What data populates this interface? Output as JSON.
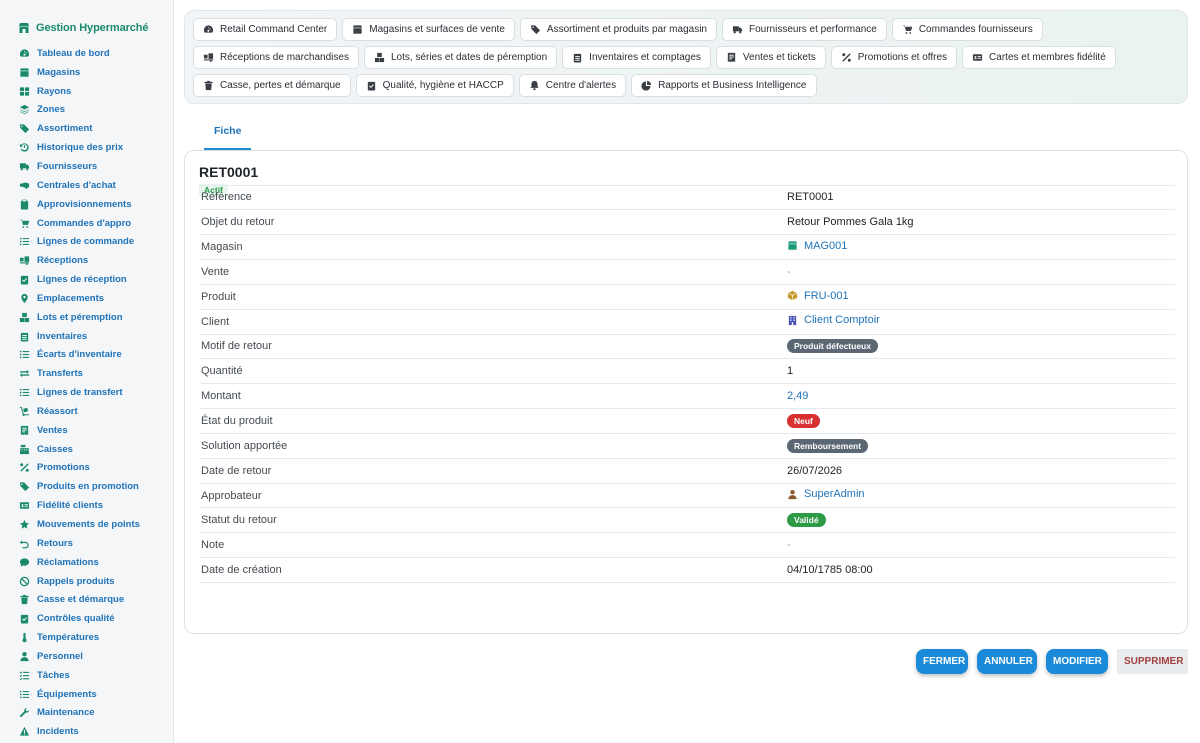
{
  "sidebar": {
    "brand": "Gestion Hypermarché",
    "items": [
      {
        "label": "Tableau de bord",
        "icon": "gauge-icon"
      },
      {
        "label": "Magasins",
        "icon": "store-icon"
      },
      {
        "label": "Rayons",
        "icon": "grid-icon"
      },
      {
        "label": "Zones",
        "icon": "layers-icon"
      },
      {
        "label": "Assortiment",
        "icon": "tags-icon"
      },
      {
        "label": "Historique des prix",
        "icon": "history-icon"
      },
      {
        "label": "Fournisseurs",
        "icon": "truck-icon"
      },
      {
        "label": "Centrales d'achat",
        "icon": "handshake-icon"
      },
      {
        "label": "Approvisionnements",
        "icon": "clipboard-icon"
      },
      {
        "label": "Commandes d'appro",
        "icon": "cart-icon"
      },
      {
        "label": "Lignes de commande",
        "icon": "list-icon"
      },
      {
        "label": "Réceptions",
        "icon": "truck-loading-icon"
      },
      {
        "label": "Lignes de réception",
        "icon": "clipboard-check-icon"
      },
      {
        "label": "Emplacements",
        "icon": "map-pin-icon"
      },
      {
        "label": "Lots et péremption",
        "icon": "boxes-icon"
      },
      {
        "label": "Inventaires",
        "icon": "clipboard-list-icon"
      },
      {
        "label": "Écarts d'inventaire",
        "icon": "list-icon"
      },
      {
        "label": "Transferts",
        "icon": "exchange-icon"
      },
      {
        "label": "Lignes de transfert",
        "icon": "list-icon"
      },
      {
        "label": "Réassort",
        "icon": "dolly-icon"
      },
      {
        "label": "Ventes",
        "icon": "receipt-icon"
      },
      {
        "label": "Caisses",
        "icon": "cash-register-icon"
      },
      {
        "label": "Promotions",
        "icon": "percent-icon"
      },
      {
        "label": "Produits en promotion",
        "icon": "tag-icon"
      },
      {
        "label": "Fidélité clients",
        "icon": "id-card-icon"
      },
      {
        "label": "Mouvements de points",
        "icon": "star-icon"
      },
      {
        "label": "Retours",
        "icon": "undo-icon"
      },
      {
        "label": "Réclamations",
        "icon": "comment-icon"
      },
      {
        "label": "Rappels produits",
        "icon": "ban-icon"
      },
      {
        "label": "Casse et démarque",
        "icon": "trash-icon"
      },
      {
        "label": "Contrôles qualité",
        "icon": "clipboard-check-icon"
      },
      {
        "label": "Températures",
        "icon": "thermometer-icon"
      },
      {
        "label": "Personnel",
        "icon": "user-icon"
      },
      {
        "label": "Tâches",
        "icon": "tasks-icon"
      },
      {
        "label": "Équipements",
        "icon": "list-icon"
      },
      {
        "label": "Maintenance",
        "icon": "wrench-icon"
      },
      {
        "label": "Incidents",
        "icon": "warning-icon"
      }
    ]
  },
  "topnav": {
    "chips": [
      {
        "label": "Retail Command Center",
        "icon": "gauge-icon"
      },
      {
        "label": "Magasins et surfaces de vente",
        "icon": "store-icon"
      },
      {
        "label": "Assortiment et produits par magasin",
        "icon": "tags-icon"
      },
      {
        "label": "Fournisseurs et performance",
        "icon": "truck-icon"
      },
      {
        "label": "Commandes fournisseurs",
        "icon": "cart-icon"
      },
      {
        "label": "Réceptions de marchandises",
        "icon": "truck-loading-icon"
      },
      {
        "label": "Lots, séries et dates de péremption",
        "icon": "boxes-icon"
      },
      {
        "label": "Inventaires et comptages",
        "icon": "clipboard-list-icon"
      },
      {
        "label": "Ventes et tickets",
        "icon": "receipt-icon"
      },
      {
        "label": "Promotions et offres",
        "icon": "percent-icon"
      },
      {
        "label": "Cartes et membres fidélité",
        "icon": "id-card-icon"
      },
      {
        "label": "Casse, pertes et démarque",
        "icon": "trash-icon"
      },
      {
        "label": "Qualité, hygiène et HACCP",
        "icon": "clipboard-check-icon"
      },
      {
        "label": "Centre d'alertes",
        "icon": "bell-icon"
      },
      {
        "label": "Rapports et Business Intelligence",
        "icon": "pie-chart-icon"
      }
    ]
  },
  "tabs": [
    {
      "label": "Fiche"
    }
  ],
  "record": {
    "title": "RET0001",
    "status": "Actif",
    "rows": [
      {
        "label": "Référence",
        "value": "RET0001",
        "kind": "text"
      },
      {
        "label": "Objet du retour",
        "value": "Retour Pommes Gala 1kg",
        "kind": "text"
      },
      {
        "label": "Magasin",
        "value": "MAG001",
        "kind": "link",
        "icon": "store-icon",
        "icon_color": "#1b9a7a"
      },
      {
        "label": "Vente",
        "value": "-",
        "kind": "dash"
      },
      {
        "label": "Produit",
        "value": "FRU-001",
        "kind": "link",
        "icon": "box-icon",
        "icon_color": "#c49a2c"
      },
      {
        "label": "Client",
        "value": "Client Comptoir",
        "kind": "link",
        "icon": "building-icon",
        "icon_color": "#4a52b8"
      },
      {
        "label": "Motif de retour",
        "value": "Produit défectueux",
        "kind": "pill",
        "color": "#5b6874"
      },
      {
        "label": "Quantité",
        "value": "1",
        "kind": "text"
      },
      {
        "label": "Montant",
        "value": "2,49",
        "kind": "number"
      },
      {
        "label": "État du produit",
        "value": "Neuf",
        "kind": "pill",
        "color": "#d93131"
      },
      {
        "label": "Solution apportée",
        "value": "Remboursement",
        "kind": "pill",
        "color": "#5b6874"
      },
      {
        "label": "Date de retour",
        "value": "26/07/2026",
        "kind": "text"
      },
      {
        "label": "Approbateur",
        "value": "SuperAdmin",
        "kind": "link",
        "icon": "user-icon",
        "icon_color": "#8a5a33"
      },
      {
        "label": "Statut du retour",
        "value": "Validé",
        "kind": "pill",
        "color": "#2d9a46"
      },
      {
        "label": "Note",
        "value": "-",
        "kind": "dash"
      },
      {
        "label": "Date de création",
        "value": "04/10/1785 08:00",
        "kind": "text"
      }
    ]
  },
  "actions": {
    "close": "FERMER",
    "cancel": "ANNULER",
    "edit": "MODIFIER",
    "delete": "SUPPRIMER"
  },
  "colors": {
    "accent": "#1a8ad9",
    "brand": "#1b8a6b",
    "link": "#1f73b8"
  }
}
